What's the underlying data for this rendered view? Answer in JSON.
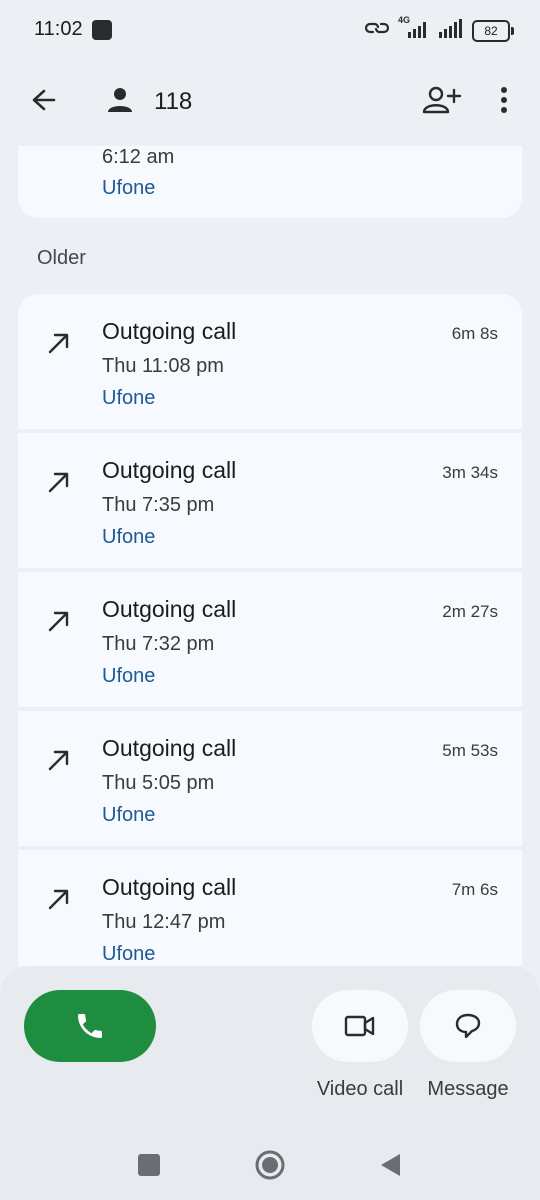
{
  "status_bar": {
    "time": "11:02",
    "network_type": "4G",
    "battery": "82"
  },
  "header": {
    "contact_name": "118"
  },
  "recent_partial": {
    "time": "6:12 am",
    "carrier": "Ufone"
  },
  "section": {
    "older_label": "Older"
  },
  "calls": [
    {
      "type": "Outgoing call",
      "time": "Thu 11:08 pm",
      "carrier": "Ufone",
      "duration": "6m 8s"
    },
    {
      "type": "Outgoing call",
      "time": "Thu 7:35 pm",
      "carrier": "Ufone",
      "duration": "3m 34s"
    },
    {
      "type": "Outgoing call",
      "time": "Thu 7:32 pm",
      "carrier": "Ufone",
      "duration": "2m 27s"
    },
    {
      "type": "Outgoing call",
      "time": "Thu 5:05 pm",
      "carrier": "Ufone",
      "duration": "5m 53s"
    },
    {
      "type": "Outgoing call",
      "time": "Thu 12:47 pm",
      "carrier": "Ufone",
      "duration": "7m 6s"
    }
  ],
  "actions": {
    "video_label": "Video call",
    "message_label": "Message"
  },
  "colors": {
    "call_green": "#1f8d3f",
    "carrier_blue": "#1f5a96",
    "card_bg": "#f6f9fd",
    "page_bg": "#eceff4"
  },
  "icons": {
    "back": "arrow-left-icon",
    "contact": "person-icon",
    "add_contact": "person-add-icon",
    "more": "more-vert-icon",
    "outgoing": "arrow-outgoing-icon",
    "phone": "phone-icon",
    "video": "videocam-icon",
    "message": "chat-bubble-icon"
  }
}
